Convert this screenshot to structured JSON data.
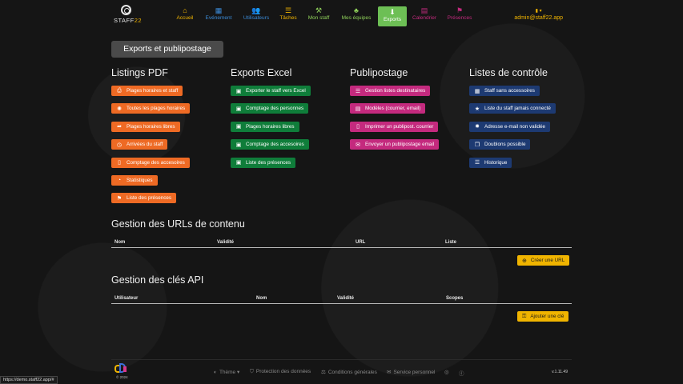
{
  "brand": {
    "text": "STAFF",
    "num": "22"
  },
  "nav": {
    "items": [
      {
        "label": "Accueil",
        "icon": "home-icon",
        "glyph": "⌂",
        "color": "#f0b400"
      },
      {
        "label": "Evénement",
        "icon": "calendar-icon",
        "glyph": "▦",
        "color": "#3b8bd8"
      },
      {
        "label": "Utilisateurs",
        "icon": "users-icon",
        "glyph": "👥",
        "color": "#3b8bd8"
      },
      {
        "label": "Tâches",
        "icon": "tasks-icon",
        "glyph": "☰",
        "color": "#f0b400"
      },
      {
        "label": "Mon staff",
        "icon": "staff-icon",
        "glyph": "⚒",
        "color": "#8fd05a"
      },
      {
        "label": "Mes équipes",
        "icon": "teams-icon",
        "glyph": "♣",
        "color": "#8fd05a"
      },
      {
        "label": "Exports",
        "icon": "export-icon",
        "glyph": "⬇",
        "color": "#ffffff"
      },
      {
        "label": "Calendrier",
        "icon": "calendar-grid-icon",
        "glyph": "▤",
        "color": "#c42a7e"
      },
      {
        "label": "Présences",
        "icon": "presence-icon",
        "glyph": "⚑",
        "color": "#c42a7e"
      }
    ],
    "user": "admin@staff22.app"
  },
  "page_title": "Exports et publipostage",
  "sections": {
    "pdf": {
      "title": "Listings PDF",
      "buttons": [
        {
          "label": "Plages horaires et staff",
          "glyph": "⎙"
        },
        {
          "label": "Toutes les plages horaires",
          "glyph": "✺"
        },
        {
          "label": "Plages horaires libres",
          "glyph": "➦"
        },
        {
          "label": "Arrivées du staff",
          "glyph": "◷"
        },
        {
          "label": "Comptage des accesoires",
          "glyph": "▯"
        },
        {
          "label": "Statistiques",
          "glyph": "◔"
        },
        {
          "label": "Liste des présences",
          "glyph": "⚑"
        }
      ]
    },
    "excel": {
      "title": "Exports Excel",
      "buttons": [
        {
          "label": "Exporter le staff vers Excel",
          "glyph": "▣"
        },
        {
          "label": "Comptage des personnes",
          "glyph": "▣"
        },
        {
          "label": "Plages horaires libres",
          "glyph": "▣"
        },
        {
          "label": "Comptage des accesoires",
          "glyph": "▣"
        },
        {
          "label": "Liste des présences",
          "glyph": "▣"
        }
      ]
    },
    "mail": {
      "title": "Publipostage",
      "buttons": [
        {
          "label": "Gestion listes destinataires",
          "glyph": "☰"
        },
        {
          "label": "Modèles (courrier, email)",
          "glyph": "▤"
        },
        {
          "label": "Imprimer un publipost. courrier",
          "glyph": "▯"
        },
        {
          "label": "Envoyer un publipostage email",
          "glyph": "✉"
        }
      ]
    },
    "checks": {
      "title": "Listes de contrôle",
      "buttons": [
        {
          "label": "Staff sans accessoires",
          "glyph": "▦"
        },
        {
          "label": "Liste du staff jamais connecté",
          "glyph": "★"
        },
        {
          "label": "Adresse e-mail non validée",
          "glyph": "✸"
        },
        {
          "label": "Doublons possible",
          "glyph": "❐"
        },
        {
          "label": "Historique",
          "glyph": "☰"
        }
      ]
    }
  },
  "urls": {
    "title": "Gestion des URLs de contenu",
    "columns": [
      "Nom",
      "Validité",
      "URL",
      "Liste"
    ],
    "button": "Créer une URL"
  },
  "api": {
    "title": "Gestion des clés API",
    "columns": [
      "Utilisateur",
      "Nom",
      "Validité",
      "Scopes"
    ],
    "button": "Ajouter une clé"
  },
  "footer": {
    "copyright": "© 2024",
    "links": [
      {
        "label": "Thème ▾",
        "icon": "palette-icon",
        "glyph": "◐"
      },
      {
        "label": "Protection des données",
        "icon": "shield-icon",
        "glyph": "⛉"
      },
      {
        "label": "Conditions générales",
        "icon": "gavel-icon",
        "glyph": "⚖"
      },
      {
        "label": "Service personnel",
        "icon": "mail-icon",
        "glyph": "✉"
      }
    ],
    "social": [
      {
        "icon": "instagram-icon",
        "glyph": "◎"
      },
      {
        "icon": "facebook-icon",
        "glyph": "ⓕ"
      }
    ],
    "version": "v.1.11.49"
  },
  "status_url": "https://demo.staff22.app/#"
}
